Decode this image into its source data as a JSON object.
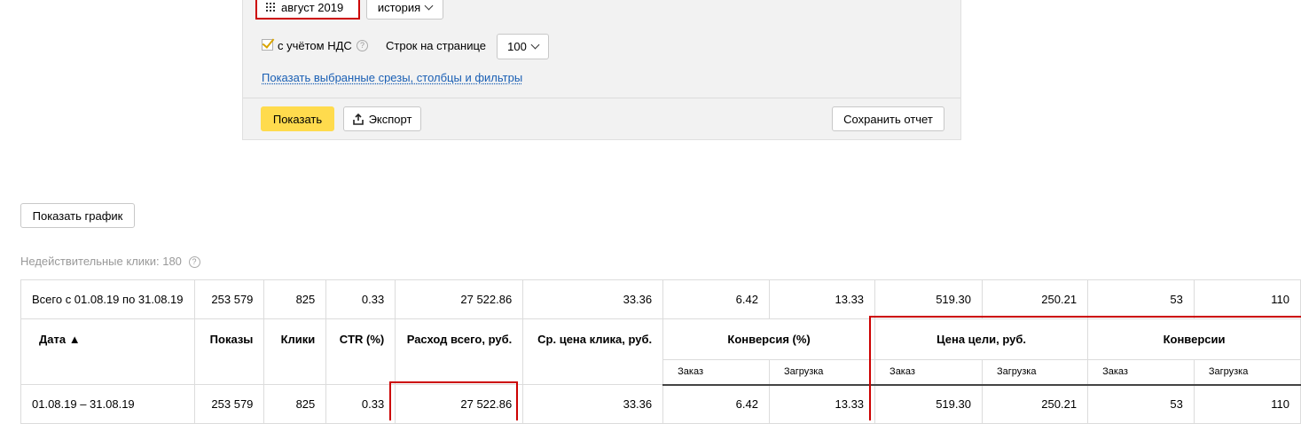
{
  "filters": {
    "period_label": "август 2019",
    "history_label": "история",
    "vat_label": "с учётом НДС",
    "vat_checked": true,
    "rows_label": "Строк на странице",
    "rows_value": "100",
    "show_filters_link": "Показать выбранные срезы, столбцы и фильтры",
    "show_button": "Показать",
    "export_button": "Экспорт",
    "save_button": "Сохранить отчет"
  },
  "chart_button": "Показать график",
  "invalid_clicks": "Недействительные клики: 180",
  "table": {
    "total_row": [
      "Всего с 01.08.19 по 31.08.19",
      "253 579",
      "825",
      "0.33",
      "27 522.86",
      "33.36",
      "6.42",
      "13.33",
      "519.30",
      "250.21",
      "53",
      "110"
    ],
    "headers": {
      "date": "Дата ▲",
      "shows": "Показы",
      "clicks": "Клики",
      "ctr": "CTR (%)",
      "spend": "Расход всего, руб.",
      "cpc": "Ср. цена клика, руб.",
      "conversion_pct": "Конверсия (%)",
      "goal_price": "Цена цели, руб.",
      "conversions": "Конверсии"
    },
    "subheaders": [
      "Заказ",
      "Загрузка",
      "Заказ",
      "Загрузка",
      "Заказ",
      "Загрузка"
    ],
    "data_rows": [
      [
        "01.08.19 – 31.08.19",
        "253 579",
        "825",
        "0.33",
        "27 522.86",
        "33.36",
        "6.42",
        "13.33",
        "519.30",
        "250.21",
        "53",
        "110"
      ]
    ]
  },
  "colors": {
    "accent_yellow": "#ffdb4d",
    "highlight_red": "#cc0000",
    "link_blue": "#1a5fb4"
  }
}
